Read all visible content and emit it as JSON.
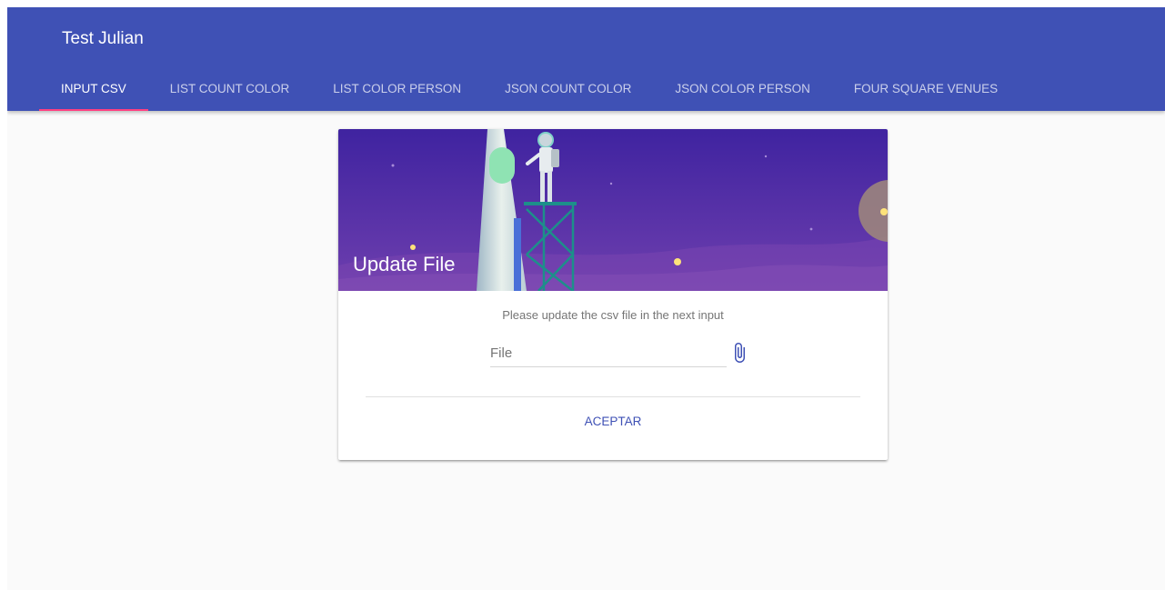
{
  "app": {
    "title": "Test Julian"
  },
  "tabs": [
    {
      "label": "INPUT CSV",
      "active": true
    },
    {
      "label": "LIST COUNT COLOR",
      "active": false
    },
    {
      "label": "LIST COLOR PERSON",
      "active": false
    },
    {
      "label": "JSON COUNT COLOR",
      "active": false
    },
    {
      "label": "JSON COLOR PERSON",
      "active": false
    },
    {
      "label": "FOUR SQUARE VENUES",
      "active": false
    }
  ],
  "card": {
    "media_title": "Update File",
    "supporting_text": "Please update the csv file in the next input",
    "file_input": {
      "placeholder": "File",
      "value": ""
    },
    "accept_label": "ACEPTAR"
  },
  "icons": {
    "attach": "attach-file-icon"
  },
  "colors": {
    "primary": "#3f51b5",
    "accent": "#ff4081",
    "background": "#fafafa",
    "media_top": "#3f23a0",
    "media_bottom": "#6e3fae"
  }
}
